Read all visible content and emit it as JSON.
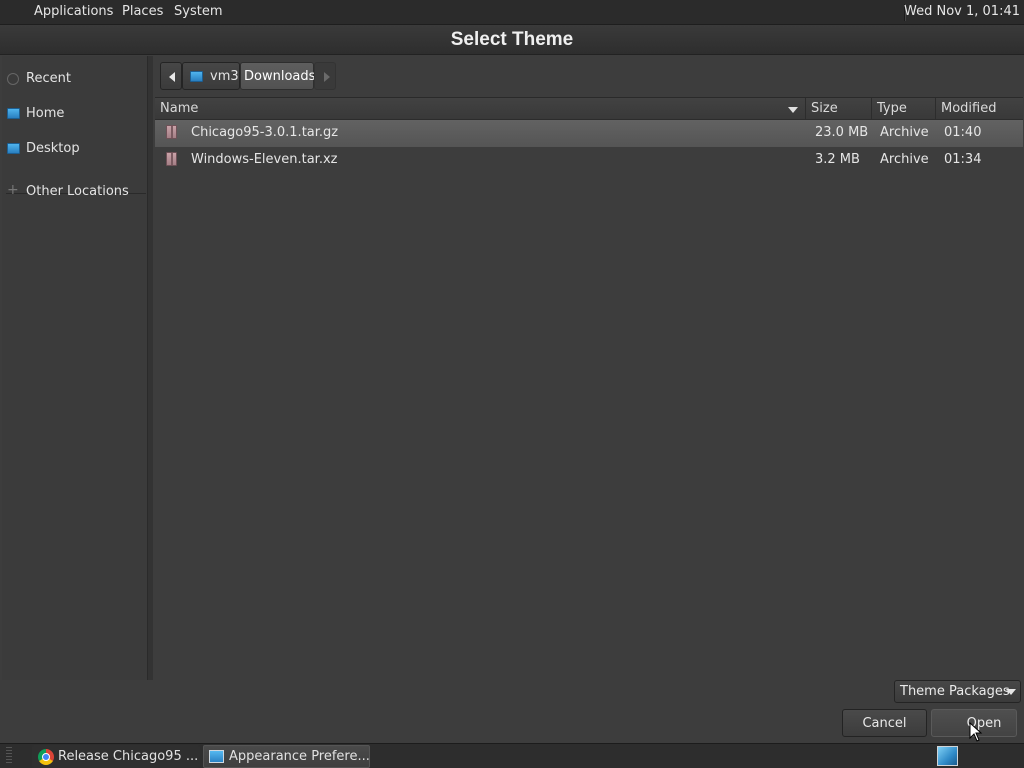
{
  "top_panel": {
    "menus": [
      "Applications",
      "Places",
      "System"
    ],
    "clock": "Wed Nov 1, 01:41"
  },
  "dialog": {
    "title": "Select Theme",
    "sidebar": {
      "items": [
        {
          "label": "Recent",
          "icon": "clock-icon"
        },
        {
          "label": "Home",
          "icon": "home-folder-icon"
        },
        {
          "label": "Desktop",
          "icon": "desktop-icon"
        },
        {
          "label": "Other Locations",
          "icon": "plus-icon"
        }
      ]
    },
    "pathbar": {
      "segments": [
        "vm3",
        "Downloads"
      ],
      "active": "Downloads"
    },
    "columns": [
      "Name",
      "Size",
      "Type",
      "Modified"
    ],
    "sort_column": "Name",
    "files": [
      {
        "name": "Chicago95-3.0.1.tar.gz",
        "size": "23.0 MB",
        "type": "Archive",
        "modified": "01:40",
        "selected": true
      },
      {
        "name": "Windows-Eleven.tar.xz",
        "size": "3.2 MB",
        "type": "Archive",
        "modified": "01:34",
        "selected": false
      }
    ],
    "filter": "Theme Packages",
    "buttons": {
      "cancel": "Cancel",
      "open": "Open"
    }
  },
  "taskbar": {
    "tasks": [
      {
        "label": "Release Chicago95 ...",
        "icon": "chrome-icon",
        "active": false
      },
      {
        "label": "Appearance Prefere...",
        "icon": "appearance-icon",
        "active": true
      }
    ],
    "tray_icon": "display-settings-icon"
  },
  "colors": {
    "panel_bg": "#2b2b2b",
    "dialog_bg": "#3d3d3d",
    "selection_bg": "#5c5c5c",
    "text": "#e6e6e6"
  }
}
